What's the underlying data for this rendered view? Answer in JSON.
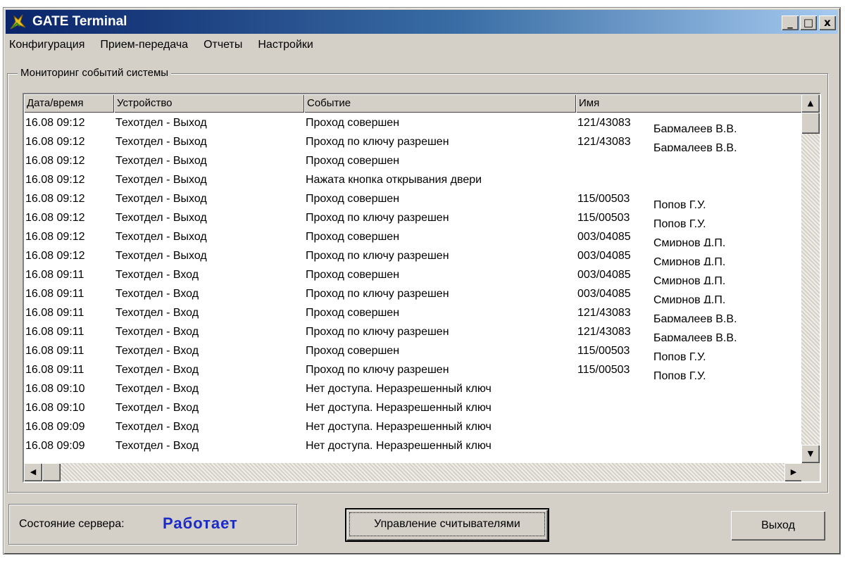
{
  "window": {
    "title": "GATE Terminal"
  },
  "titlebar_buttons": {
    "minimize": "_",
    "maximize": "□",
    "close": "x"
  },
  "menu": [
    "Конфигурация",
    "Прием-передача",
    "Отчеты",
    "Настройки"
  ],
  "monitor": {
    "group_label": "Мониторинг событий системы",
    "columns": [
      "Дата/время",
      "Устройство",
      "Событие",
      "Имя"
    ],
    "rows": [
      [
        "16.08  09:12",
        "Техотдел - Выход",
        "Проход совершен",
        "121/43083",
        "Бармалеев В.В."
      ],
      [
        "16.08  09:12",
        "Техотдел - Выход",
        "Проход по ключу разрешен",
        "121/43083",
        "Бармалеев В.В."
      ],
      [
        "16.08  09:12",
        "Техотдел - Выход",
        "Проход совершен",
        "",
        ""
      ],
      [
        "16.08  09:12",
        "Техотдел - Выход",
        "Нажата кнопка открывания двери",
        "",
        ""
      ],
      [
        "16.08  09:12",
        "Техотдел - Выход",
        "Проход совершен",
        "115/00503",
        "Попов Г.У."
      ],
      [
        "16.08  09:12",
        "Техотдел - Выход",
        "Проход по ключу разрешен",
        "115/00503",
        "Попов Г.У."
      ],
      [
        "16.08  09:12",
        "Техотдел - Выход",
        "Проход совершен",
        "003/04085",
        "Смирнов Д.П."
      ],
      [
        "16.08  09:12",
        "Техотдел - Выход",
        "Проход по ключу разрешен",
        "003/04085",
        "Смирнов Д.П."
      ],
      [
        "16.08  09:11",
        "Техотдел - Вход",
        "Проход совершен",
        "003/04085",
        "Смирнов Д.П."
      ],
      [
        "16.08  09:11",
        "Техотдел - Вход",
        "Проход по ключу разрешен",
        "003/04085",
        "Смирнов Д.П."
      ],
      [
        "16.08  09:11",
        "Техотдел - Вход",
        "Проход совершен",
        "121/43083",
        "Бармалеев В.В."
      ],
      [
        "16.08  09:11",
        "Техотдел - Вход",
        "Проход по ключу разрешен",
        "121/43083",
        "Бармалеев В.В."
      ],
      [
        "16.08  09:11",
        "Техотдел - Вход",
        "Проход совершен",
        "115/00503",
        "Попов Г.У."
      ],
      [
        "16.08  09:11",
        "Техотдел - Вход",
        "Проход по ключу разрешен",
        "115/00503",
        "Попов Г.У."
      ],
      [
        "16.08  09:10",
        "Техотдел - Вход",
        "Нет доступа. Неразрешенный ключ",
        "",
        ""
      ],
      [
        "16.08  09:10",
        "Техотдел - Вход",
        "Нет доступа. Неразрешенный ключ",
        "",
        ""
      ],
      [
        "16.08  09:09",
        "Техотдел - Вход",
        "Нет доступа. Неразрешенный ключ",
        "",
        ""
      ],
      [
        "16.08  09:09",
        "Техотдел - Вход",
        "Нет доступа. Неразрешенный ключ",
        "",
        ""
      ]
    ]
  },
  "status": {
    "label": "Состояние сервера:",
    "value": "Работает",
    "value_color": "#1a2bc8"
  },
  "buttons": {
    "readers": "Управление считывателями",
    "exit": "Выход"
  },
  "scroll_glyphs": {
    "up": "▲",
    "down": "▼",
    "left": "◀",
    "right": "▶"
  },
  "colors": {
    "titlebar_start": "#0a246a",
    "titlebar_end": "#a6caf0",
    "face": "#d4d0c8"
  }
}
